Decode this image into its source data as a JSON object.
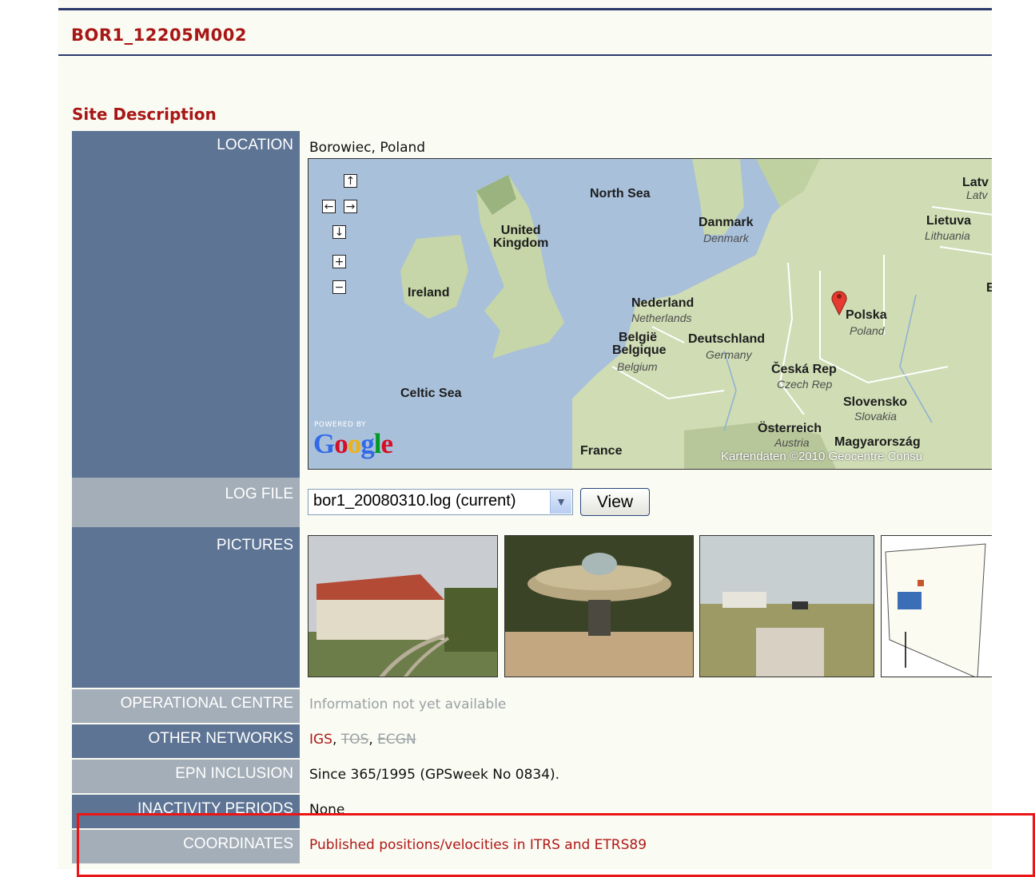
{
  "site": {
    "title": "BOR1_12205M002"
  },
  "section": {
    "title": "Site Description"
  },
  "location": {
    "label": "LOCATION",
    "value": "Borowiec, Poland"
  },
  "map": {
    "labels": {
      "north_sea": "North Sea",
      "united_kingdom": "United\nKingdom",
      "ireland": "Ireland",
      "celtic_sea": "Celtic Sea",
      "danmark": "Danmark",
      "denmark": "Denmark",
      "lietuva": "Lietuva",
      "lithuania": "Lithuania",
      "latvia_top": "Latv",
      "latvia_sub": "Latv",
      "nederland": "Nederland",
      "netherlands": "Netherlands",
      "belgie": "België",
      "belgique": "Belgique",
      "belgium": "Belgium",
      "deutschland": "Deutschland",
      "germany": "Germany",
      "polska": "Polska",
      "poland": "Poland",
      "ceska": "Česká Rep",
      "czech": "Czech Rep",
      "slovensko": "Slovensko",
      "slovakia": "Slovakia",
      "osterreich": "Österreich",
      "austria": "Austria",
      "magyarorszag": "Magyarország",
      "france": "France",
      "b_char": "Б"
    },
    "controls": {
      "up": "↑",
      "left": "←",
      "right": "→",
      "down": "↓",
      "zoom_in": "+",
      "zoom_out": "−"
    },
    "powered_by": "POWERED BY",
    "logo": "Google",
    "copyright": "Kartendaten ©2010 Geocentre Consu",
    "marker_color": "#e53a2f"
  },
  "log_file": {
    "label": "LOG FILE",
    "selected": "bor1_20080310.log (current)",
    "arrow": "▼",
    "view_button": "View"
  },
  "pictures": {
    "label": "PICTURES",
    "items": [
      "building",
      "antenna",
      "field-station",
      "site-plan"
    ]
  },
  "operational_centre": {
    "label": "OPERATIONAL CENTRE",
    "value": "Information not yet available"
  },
  "other_networks": {
    "label": "OTHER NETWORKS",
    "igs": "IGS",
    "sep": ", ",
    "tos": "TOS",
    "ecgn": "ECGN"
  },
  "epn_inclusion": {
    "label": "EPN INCLUSION",
    "value": "Since 365/1995 (GPSweek No 0834)."
  },
  "inactivity": {
    "label": "INACTIVITY PERIODS",
    "value": "None"
  },
  "coordinates": {
    "label": "COORDINATES",
    "value": "Published positions/velocities in ITRS and ETRS89"
  },
  "colors": {
    "title_red": "#a81616",
    "label_dark": "#5d7494",
    "label_light": "#a4aeb8",
    "highlight_box": "#ec1515"
  }
}
